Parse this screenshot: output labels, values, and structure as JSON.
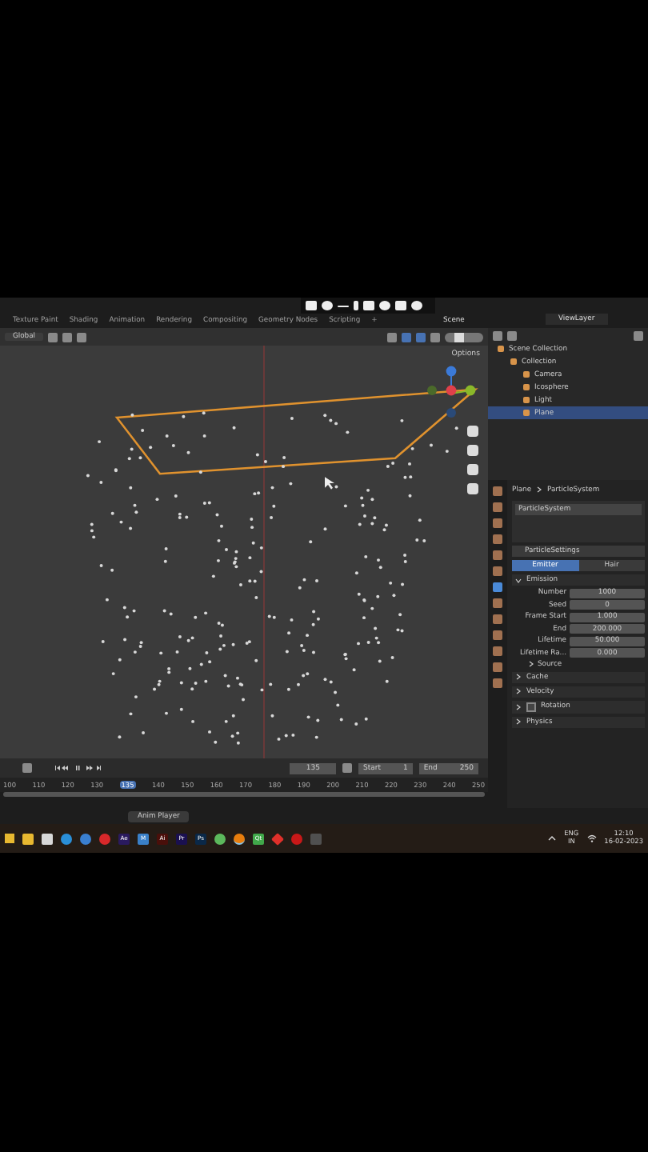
{
  "workspace_tabs": [
    {
      "label": "Texture Paint",
      "selected": false
    },
    {
      "label": "Shading",
      "selected": false
    },
    {
      "label": "Animation",
      "selected": false
    },
    {
      "label": "Rendering",
      "selected": false
    },
    {
      "label": "Compositing",
      "selected": false
    },
    {
      "label": "Geometry Nodes",
      "selected": false
    },
    {
      "label": "Scripting",
      "selected": false
    }
  ],
  "add_tab": "+",
  "scene": "Scene",
  "view_layer": "ViewLayer",
  "viewport": {
    "orientation": "Global",
    "options": "Options"
  },
  "outliner": {
    "items": [
      {
        "label": "Scene Collection",
        "selected": false,
        "children": [
          {
            "label": "Collection",
            "selected": false,
            "children": [
              {
                "label": "Camera",
                "selected": false
              },
              {
                "label": "Icosphere",
                "selected": false
              },
              {
                "label": "Light",
                "selected": false
              },
              {
                "label": "Plane",
                "selected": true
              }
            ]
          }
        ]
      }
    ]
  },
  "properties": {
    "breadcrumb": [
      "Plane",
      "ParticleSystem"
    ],
    "system": "ParticleSystem",
    "settings": "ParticleSettings",
    "tabs": [
      {
        "label": "Emitter",
        "selected": true
      },
      {
        "label": "Hair",
        "selected": false
      }
    ],
    "panels": [
      {
        "title": "Emission",
        "expanded": true,
        "fields": [
          {
            "label": "Number",
            "value": "1000"
          },
          {
            "label": "Seed",
            "value": "0"
          },
          {
            "label": "Frame Start",
            "value": "1.000"
          },
          {
            "label": "End",
            "value": "200.000"
          },
          {
            "label": "Lifetime",
            "value": "50.000"
          },
          {
            "label": "Lifetime Ra...",
            "value": "0.000"
          }
        ],
        "subpanels": [
          {
            "title": "Source",
            "expanded": false
          }
        ]
      },
      {
        "title": "Cache",
        "expanded": false
      },
      {
        "title": "Velocity",
        "expanded": false
      },
      {
        "title": "Rotation",
        "expanded": false,
        "checked": false
      },
      {
        "title": "Physics",
        "expanded": false
      }
    ]
  },
  "timeline": {
    "frame": "135",
    "start_label": "Start",
    "start": "1",
    "end_label": "End",
    "end": "250",
    "ticks": [
      {
        "label": "100",
        "selected": false
      },
      {
        "label": "110",
        "selected": false
      },
      {
        "label": "120",
        "selected": false
      },
      {
        "label": "130",
        "selected": false
      },
      {
        "label": "135",
        "selected": true
      },
      {
        "label": "140",
        "selected": false
      },
      {
        "label": "150",
        "selected": false
      },
      {
        "label": "160",
        "selected": false
      },
      {
        "label": "170",
        "selected": false
      },
      {
        "label": "180",
        "selected": false
      },
      {
        "label": "190",
        "selected": false
      },
      {
        "label": "200",
        "selected": false
      },
      {
        "label": "210",
        "selected": false
      },
      {
        "label": "220",
        "selected": false
      },
      {
        "label": "230",
        "selected": false
      },
      {
        "label": "240",
        "selected": false
      },
      {
        "label": "250",
        "selected": false
      }
    ]
  },
  "anim_player": "Anim Player",
  "taskbar": {
    "apps": [
      {
        "kind": "tile",
        "color": "#e8b830",
        "selected": false
      },
      {
        "kind": "tile",
        "color": "#d8d8d8",
        "selected": false
      },
      {
        "kind": "circle",
        "color": "#2a8fd8",
        "selected": false
      },
      {
        "kind": "circle",
        "color": "#3a7fd0",
        "selected": false
      },
      {
        "kind": "circle",
        "color": "#d8282a",
        "selected": false
      },
      {
        "kind": "tile",
        "color": "#2a1a5e",
        "label": "Ae",
        "selected": false
      },
      {
        "kind": "tile",
        "color": "#3a80c8",
        "label": "M",
        "selected": false
      },
      {
        "kind": "tile",
        "color": "#4a0f0a",
        "label": "Ai",
        "selected": false
      },
      {
        "kind": "tile",
        "color": "#1a1050",
        "label": "Pr",
        "selected": false
      },
      {
        "kind": "tile",
        "color": "#0a2848",
        "label": "Ps",
        "selected": false
      },
      {
        "kind": "circle",
        "color": "#5cb85c",
        "selected": false
      },
      {
        "kind": "circle",
        "color": "#e87d0d",
        "selected": true
      },
      {
        "kind": "tile",
        "color": "#41a84a",
        "label": "Qt",
        "selected": false
      },
      {
        "kind": "diamond",
        "color": "#e0302a",
        "selected": false
      },
      {
        "kind": "circle",
        "color": "#c81818",
        "selected": false
      },
      {
        "kind": "tile",
        "color": "#505050",
        "selected": false
      }
    ],
    "lang": "ENG",
    "region": "IN",
    "time": "12:10",
    "date": "16-02-2023"
  }
}
